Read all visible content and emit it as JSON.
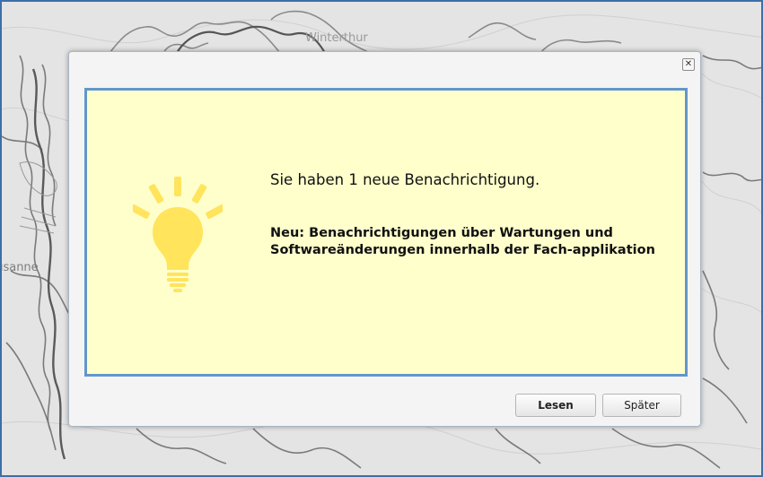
{
  "map": {
    "labels": [
      "Winterthur",
      "Lausanne"
    ]
  },
  "dialog": {
    "close_symbol": "✕",
    "icon": "lightbulb-icon",
    "headline": "Sie haben 1 neue Benachrichtigung.",
    "message": "Neu: Benachrichtigungen über Wartungen und Softwareänderungen innerhalb der Fach-applikation",
    "read_label": "Lesen",
    "later_label": "Später"
  },
  "colors": {
    "panel_background": "#ffffcc",
    "panel_border": "#6396cc",
    "bulb": "#ffe45c",
    "map_border": "#3d6fa8"
  }
}
